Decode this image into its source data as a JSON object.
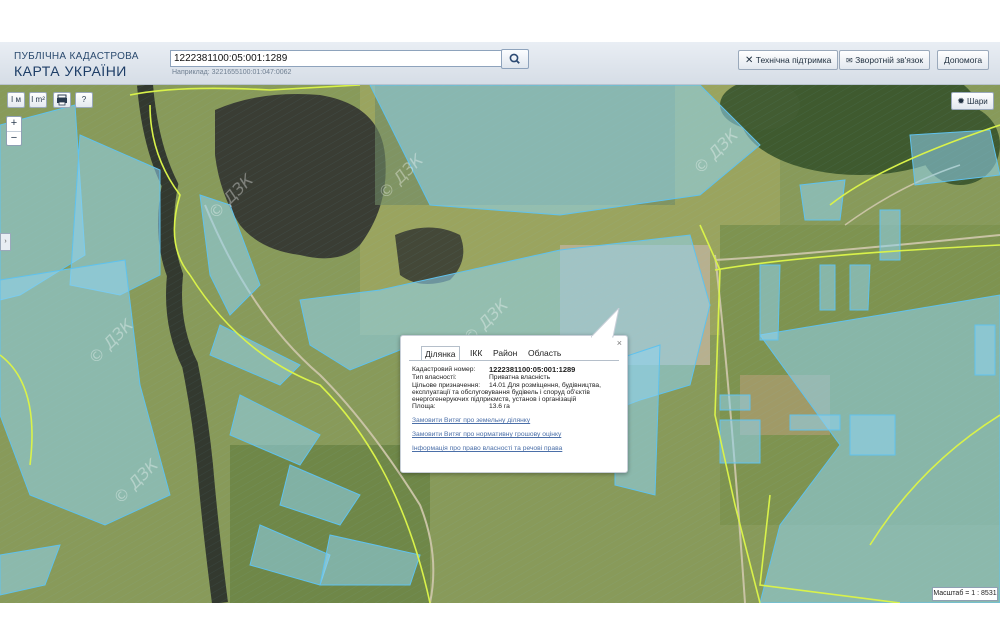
{
  "header": {
    "logo_line1": "ПУБЛІЧНА КАДАСТРОВА",
    "logo_line2": "КАРТА УКРАЇНИ",
    "search_value": "1222381100:05:001:1289",
    "search_hint": "Наприклад: 3221655100:01:047:0062",
    "buttons": {
      "support": "Технічна підтримка",
      "feedback": "Зворотній зв'язок",
      "help": "Допомога"
    }
  },
  "map": {
    "tools": [
      "I м",
      "I m²",
      "print",
      "?"
    ],
    "zoom_in": "+",
    "zoom_out": "−",
    "side_tab": "›",
    "layers_label": "Шари",
    "scale_text": "Масштаб = 1 : 8531",
    "watermark": "© ДЗК"
  },
  "popup": {
    "close": "×",
    "tabs": [
      "Ділянка",
      "ІКК",
      "Район",
      "Область"
    ],
    "labels": {
      "cadastral": "Кадастровий номер:",
      "ownership": "Тип власності:",
      "purpose": "Цільове призначення:",
      "area": "Площа:"
    },
    "values": {
      "cadastral": "1222381100:05:001:1289",
      "ownership": "Приватна власність",
      "purpose_line1": "14.01 Для розміщення, будівництва,",
      "purpose_line2": "експлуатації та обслуговування будівель і споруд об'єктів",
      "purpose_line3": "енергогенеруючих підприємств, установ і організацій",
      "area": "13.6 га"
    },
    "links": [
      "Замовити Витяг про земельну ділянку",
      "Замовити Витяг про нормативну грошову оцінку",
      "Інформація про право власності та речові права"
    ]
  },
  "colors": {
    "parcel_fill": "#8fd3f0",
    "parcel_stroke": "#5fc2ee",
    "boundary": "#d9f24a",
    "link": "#4b6fa8"
  }
}
